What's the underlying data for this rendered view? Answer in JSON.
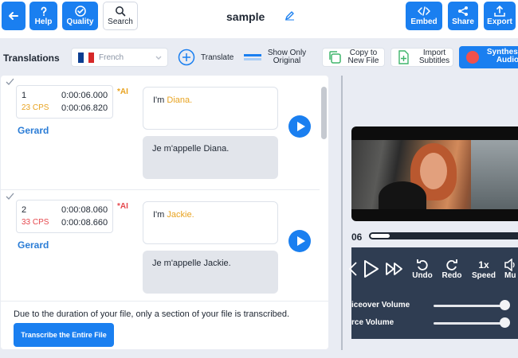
{
  "topbar": {
    "back": {
      "icon": "arrow-left-icon"
    },
    "help": {
      "label": "Help",
      "icon": "question-icon"
    },
    "quality": {
      "label": "Quality",
      "icon": "shield-check-icon"
    },
    "search": {
      "label": "Search",
      "icon": "search-icon"
    },
    "title": "sample",
    "edit_icon": "pencil-icon",
    "embed": {
      "label": "Embed",
      "icon": "code-icon"
    },
    "share": {
      "label": "Share",
      "icon": "share-icon"
    },
    "export": {
      "label": "Export",
      "icon": "upload-icon"
    },
    "accent_color": "#1a7ff0"
  },
  "toolbar": {
    "translations_label": "Translations",
    "language": {
      "value": "French",
      "flag_colors": [
        "#0b3d91",
        "#ffffff",
        "#d62828"
      ]
    },
    "translate_label": "Translate",
    "show_only_original_label": "Show Only Original",
    "copy_to_new_file_label": "Copy to New File",
    "import_subtitles_label": "Import Subtitles",
    "synthesize_audio_label": "Synthesize Audio"
  },
  "segments": [
    {
      "number": "1",
      "cps": "23 CPS",
      "cps_color": "#e8a320",
      "start": "0:00:06.000",
      "end": "0:00:06.820",
      "ai_badge": "*AI",
      "speaker": "Gerard",
      "source_prefix": "I'm ",
      "source_highlight": "Diana.",
      "translation": "Je m'appelle Diana."
    },
    {
      "number": "2",
      "cps": "33 CPS",
      "cps_color": "#e5484d",
      "start": "0:00:08.060",
      "end": "0:00:08.660",
      "ai_badge": "*AI",
      "speaker": "Gerard",
      "source_prefix": "I'm ",
      "source_highlight": "Jackie.",
      "translation": "Je m'appelle Jackie."
    }
  ],
  "footer": {
    "notice": "Due to the duration of your file, only a section of your file is transcribed.",
    "transcribe_button": "Transcribe the Entire File"
  },
  "player": {
    "time_fragment": "06",
    "progress": 0.13,
    "undo_label": "Undo",
    "redo_label": "Redo",
    "speed_value": "1x",
    "speed_label": "Speed",
    "mute_label": "Mu",
    "voiceover_volume_label": "iceover Volume",
    "source_volume_label": "rce Volume",
    "voiceover_volume": 1.0,
    "source_volume": 1.0
  }
}
